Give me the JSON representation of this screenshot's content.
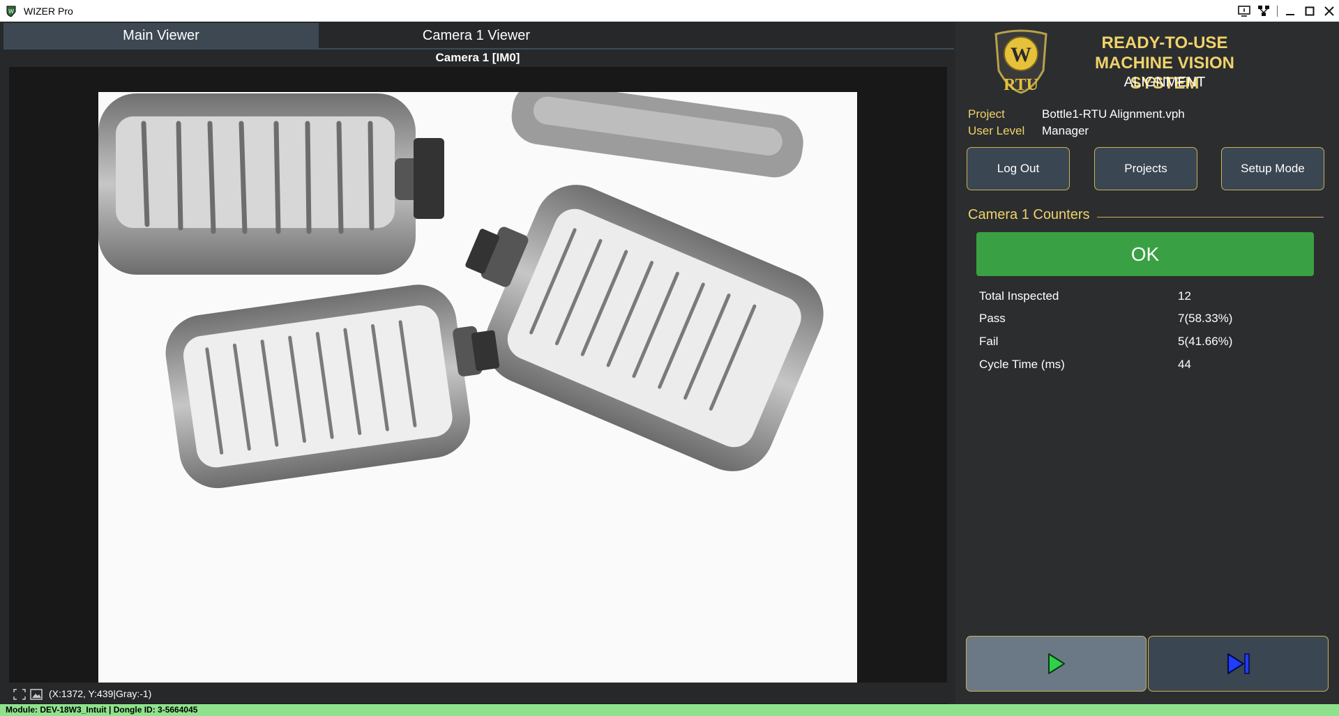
{
  "window": {
    "title": "WIZER Pro"
  },
  "tabs": [
    {
      "label": "Main Viewer",
      "active": true
    },
    {
      "label": "Camera 1 Viewer",
      "active": false
    }
  ],
  "viewer": {
    "camera_title": "Camera 1  [IM0]",
    "coords": "(X:1372, Y:439|Gray:-1)"
  },
  "brand": {
    "logo_text": "RTU",
    "line1": "READY-TO-USE",
    "line2": "MACHINE VISION SYSTEM",
    "line3": "ALIGNMENT",
    "accent": "#f0d36a"
  },
  "project_info": {
    "project_label": "Project",
    "project_value": "Bottle1-RTU Alignment.vph",
    "user_label": "User Level",
    "user_value": "Manager"
  },
  "buttons": {
    "logout": "Log Out",
    "projects": "Projects",
    "setup": "Setup Mode"
  },
  "counters": {
    "section_title": "Camera 1 Counters",
    "status": "OK",
    "status_color": "#39a143",
    "rows": [
      {
        "label": "Total Inspected",
        "value": "12"
      },
      {
        "label": "Pass",
        "value": "7(58.33%)"
      },
      {
        "label": "Fail",
        "value": "5(41.66%)"
      },
      {
        "label": "Cycle Time (ms)",
        "value": "44"
      }
    ]
  },
  "controls": {
    "play_icon": "play-icon",
    "step_icon": "step-forward-icon"
  },
  "statusbar": {
    "text": "Module: DEV-18W3_Intuit | Dongle ID: 3-5664045",
    "color": "#8fe28c"
  }
}
